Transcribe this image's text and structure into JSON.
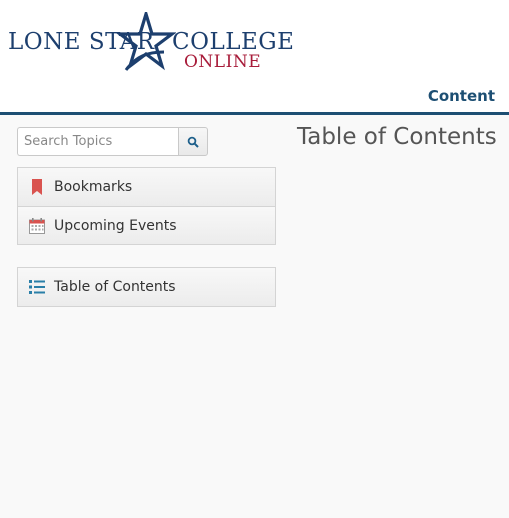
{
  "header": {
    "logo": {
      "line1": "LONE STAR",
      "line2": "COLLEGE",
      "line3": "ONLINE"
    },
    "nav_link": "Content"
  },
  "search": {
    "placeholder": "Search Topics",
    "value": ""
  },
  "sidebar": {
    "tools": [
      {
        "label": "Bookmarks",
        "icon": "bookmark-icon"
      },
      {
        "label": "Upcoming Events",
        "icon": "calendar-icon"
      }
    ],
    "toc": {
      "label": "Table of Contents",
      "icon": "list-icon"
    }
  },
  "main": {
    "title": "Table of Contents"
  },
  "colors": {
    "brand_navy": "#1d3f6e",
    "brand_red": "#a81c3a",
    "header_rule": "#1d4f73"
  }
}
